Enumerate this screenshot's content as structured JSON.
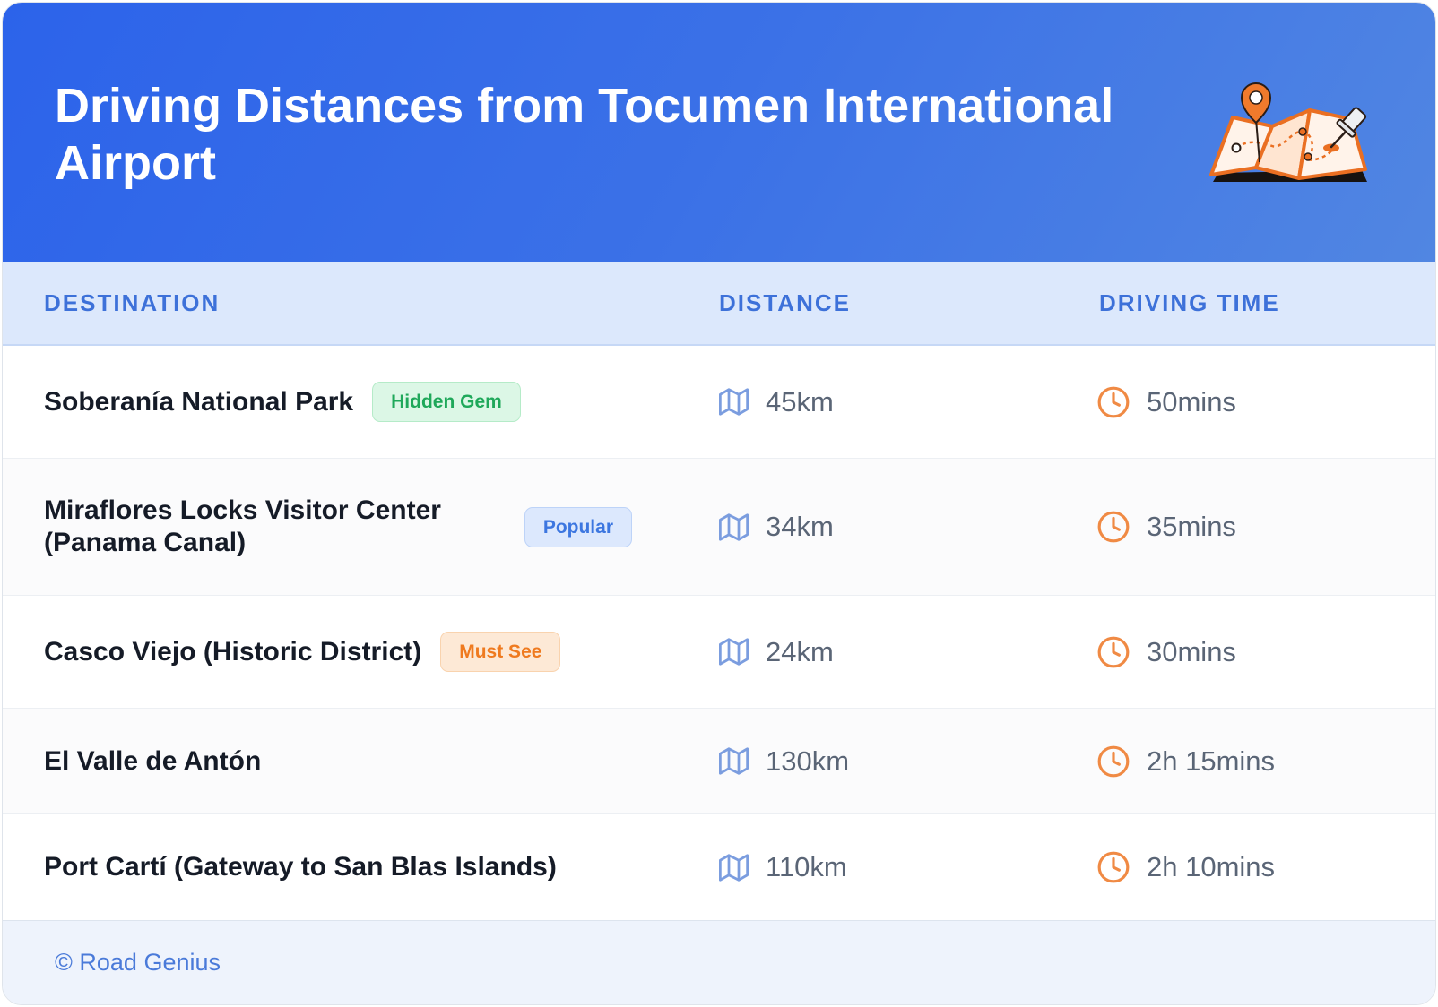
{
  "header": {
    "title": "Driving Distances from Tocumen International Airport",
    "icon": "folded-map-with-pins-icon"
  },
  "table": {
    "columns": {
      "destination": "DESTINATION",
      "distance": "DISTANCE",
      "driving_time": "DRIVING TIME"
    },
    "distance_icon": "map-icon",
    "time_icon": "clock-icon",
    "rows": [
      {
        "destination": "Soberanía National Park",
        "badge": {
          "label": "Hidden Gem",
          "text_color": "#1fa85a",
          "bg_color": "#dcf7e6",
          "border_color": "#b5ebc8"
        },
        "distance": "45km",
        "driving_time": "50mins"
      },
      {
        "destination": "Miraflores Locks Visitor Center (Panama Canal)",
        "badge": {
          "label": "Popular",
          "text_color": "#3c76e0",
          "bg_color": "#dce8fd",
          "border_color": "#bdd3f8"
        },
        "distance": "34km",
        "driving_time": "35mins"
      },
      {
        "destination": "Casco Viejo (Historic District)",
        "badge": {
          "label": "Must See",
          "text_color": "#ef7a1f",
          "bg_color": "#fde9d6",
          "border_color": "#f9d3ae"
        },
        "distance": "24km",
        "driving_time": "30mins"
      },
      {
        "destination": "El Valle de Antón",
        "distance": "130km",
        "driving_time": "2h 15mins"
      },
      {
        "destination": "Port Cartí (Gateway to San Blas Islands)",
        "distance": "110km",
        "driving_time": "2h 10mins"
      }
    ]
  },
  "footer": {
    "credit": "© Road Genius"
  },
  "colors": {
    "header_gradient_start": "#2c63ea",
    "header_gradient_end": "#5186e2",
    "accent": "#3d71d9",
    "table_header_bg": "#dce8fc",
    "footer_bg": "#eef3fc",
    "footer_text": "#4a7ad9",
    "name_text": "#151b27",
    "value_text": "#5a6576",
    "map_icon": "#7b9ddf",
    "clock_icon": "#f08a44"
  }
}
